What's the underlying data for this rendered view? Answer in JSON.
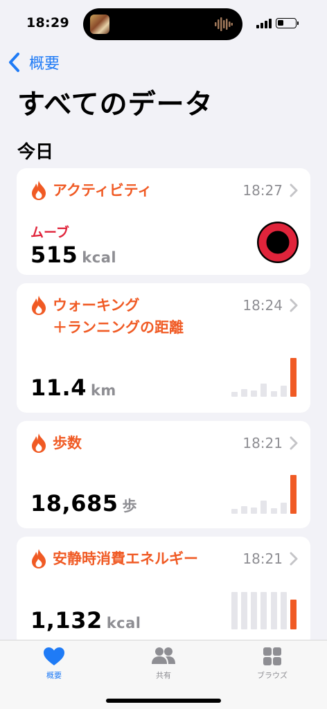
{
  "status": {
    "time": "18:29"
  },
  "nav": {
    "back_label": "概要"
  },
  "page_title": "すべてのデータ",
  "section_title": "今日",
  "cards": [
    {
      "title": "アクティビティ",
      "time": "18:27",
      "sub_label": "ムーブ",
      "value": "515",
      "unit": "kcal"
    },
    {
      "title_line1": "ウォーキング",
      "title_line2": "＋ランニングの距離",
      "time": "18:24",
      "value": "11.4",
      "unit": "km",
      "bars": [
        0.12,
        0.2,
        0.16,
        0.34,
        0.14,
        0.28,
        1.0
      ]
    },
    {
      "title": "歩数",
      "time": "18:21",
      "value": "18,685",
      "unit": "歩",
      "bars": [
        0.12,
        0.2,
        0.16,
        0.34,
        0.14,
        0.28,
        1.0
      ]
    },
    {
      "title": "安静時消費エネルギー",
      "time": "18:21",
      "value": "1,132",
      "unit": "kcal",
      "bars": [
        1.0,
        1.0,
        1.0,
        1.0,
        1.0,
        1.0,
        0.8
      ]
    }
  ],
  "tabs": [
    {
      "label": "概要",
      "icon": "heart-icon",
      "active": true
    },
    {
      "label": "共有",
      "icon": "people-icon",
      "active": false
    },
    {
      "label": "ブラウズ",
      "icon": "grid-icon",
      "active": false
    }
  ],
  "colors": {
    "accent": "#1f7bf6",
    "activity": "#f05a24",
    "move": "#e0243b",
    "bar_gray": "#e5e5ea"
  }
}
